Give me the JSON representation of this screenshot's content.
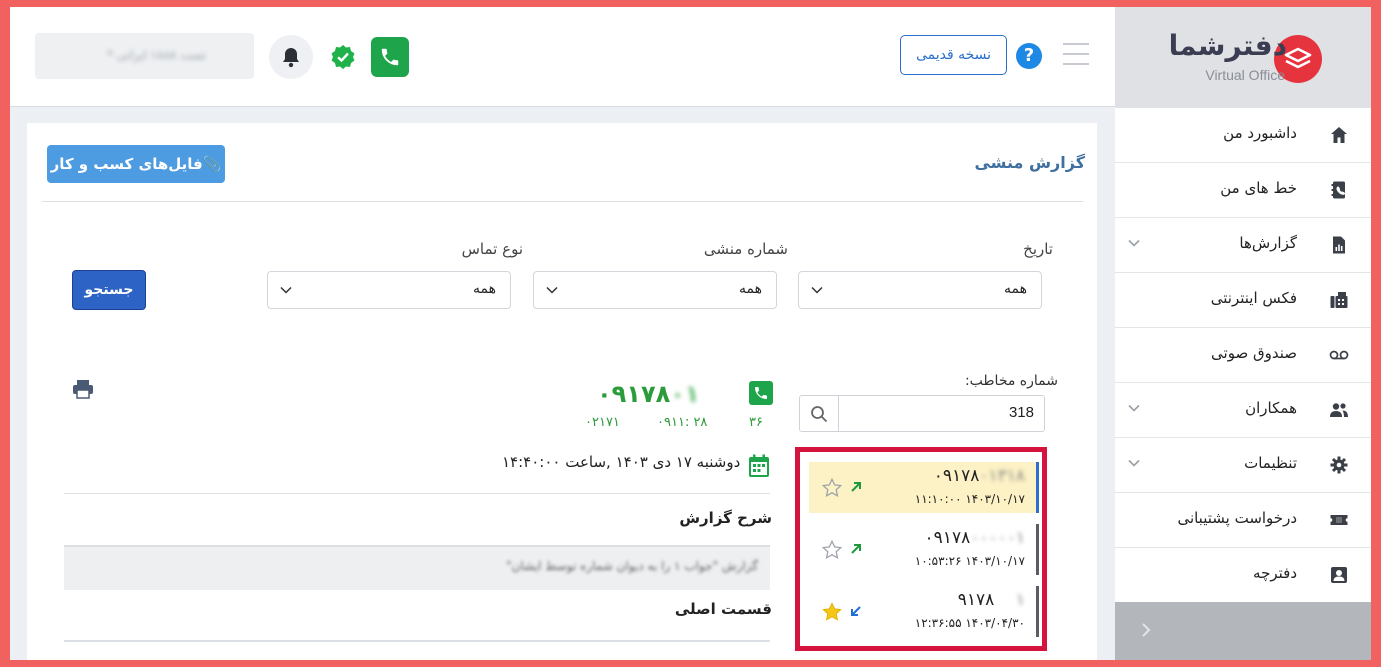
{
  "brand": {
    "name": "دفترشما",
    "subtitle": "Virtual Office"
  },
  "sidebar": {
    "items": [
      {
        "label": "داشبورد من",
        "icon": "home-icon"
      },
      {
        "label": "خط های من",
        "icon": "phonebook-icon"
      },
      {
        "label": "گزارش‌ها",
        "icon": "report-icon",
        "expandable": true
      },
      {
        "label": "فکس اینترنتی",
        "icon": "fax-icon"
      },
      {
        "label": "صندوق صوتی",
        "icon": "voicemail-icon"
      },
      {
        "label": "همکاران",
        "icon": "people-icon",
        "expandable": true
      },
      {
        "label": "تنظیمات",
        "icon": "gear-icon",
        "expandable": true
      },
      {
        "label": "درخواست پشتیبانی",
        "icon": "ticket-icon"
      },
      {
        "label": "دفترچه",
        "icon": "contact-book-icon"
      }
    ]
  },
  "header": {
    "old_version_label": "نسخه قدیمی",
    "help_label": "?",
    "account_text": "تست ۱۸۸۸ ایرانی *"
  },
  "main": {
    "title": "گزارش منشی",
    "files_button": "فایل‌های کسب و کار",
    "filters": {
      "date": {
        "label": "تاریخ",
        "value": "همه"
      },
      "secretary_number": {
        "label": "شماره منشی",
        "value": "همه"
      },
      "call_type": {
        "label": "نوع تماس",
        "value": "همه"
      }
    },
    "search_button": "جستجو",
    "caller_search": {
      "label": "شماره مخاطب:",
      "value": "318"
    },
    "calls": [
      {
        "number": "۰۹۱۷۸",
        "number_hidden": "۰۱۳۱۸",
        "time": "۱۴۰۳/۱۰/۱۷ ۱۱:۱۰:۰۰",
        "direction": "outgoing",
        "starred": false,
        "active": true
      },
      {
        "number": "۰۹۱۷۸",
        "number_hidden": "۰۰۰۰۰۱",
        "time": "۱۴۰۳/۱۰/۱۷ ۱۰:۵۳:۲۶",
        "direction": "outgoing",
        "starred": false,
        "active": false
      },
      {
        "number": "۹۱۷۸",
        "number_hidden": "۱",
        "time": "۱۴۰۳/۰۴/۳۰ ۱۲:۳۶:۵۵",
        "direction": "incoming",
        "starred": true,
        "active": false
      }
    ],
    "detail": {
      "number": "۰۹۱۷۸",
      "number_hidden": "۰۱",
      "meta_1": "۳۶",
      "meta_2": "۲۸ :۰۹۱۱",
      "meta_3": "۰۲۱۷۱",
      "date_text": "دوشنبه ۱۷ دی ۱۴۰۳ ,ساعت ۱۴:۴۰:۰۰",
      "report_title": "شرح گزارش",
      "report_text": "گزارش \"جواب ۱ را به دیوان شماره توسط ایشان\"",
      "main_section_title": "قسمت اصلی"
    }
  },
  "colors": {
    "brand_red": "#e5343e",
    "accent_blue": "#2e63c6",
    "green": "#1ea44a",
    "highlight_red": "#d4143e"
  }
}
